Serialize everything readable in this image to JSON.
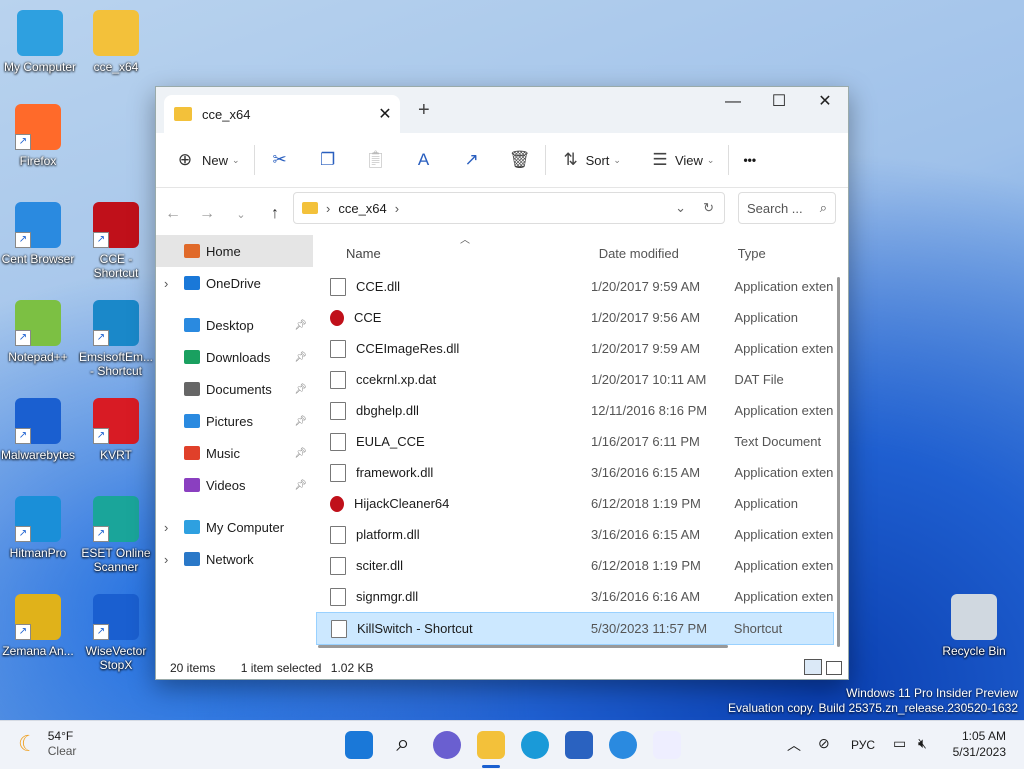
{
  "desktop": {
    "icons": [
      {
        "label": "My Computer",
        "color": "#2ea0e0"
      },
      {
        "label": "cce_x64",
        "color": "#f3c13a"
      },
      {
        "label": "Firefox",
        "color": "#ff6a2a"
      },
      {
        "label": "Cent Browser",
        "color": "#2a8ae0"
      },
      {
        "label": "CCE - Shortcut",
        "color": "#c0101a"
      },
      {
        "label": "Notepad++",
        "color": "#7cc043"
      },
      {
        "label": "EmsisoftEm... - Shortcut",
        "color": "#1a88c9"
      },
      {
        "label": "Malwarebytes",
        "color": "#1a5fd0"
      },
      {
        "label": "KVRT",
        "color": "#d81b24"
      },
      {
        "label": "HitmanPro",
        "color": "#1a8fd8"
      },
      {
        "label": "ESET Online Scanner",
        "color": "#1aa59a"
      },
      {
        "label": "Zemana An...",
        "color": "#e0b21a"
      },
      {
        "label": "WiseVector StopX",
        "color": "#1a5fd0"
      },
      {
        "label": "Recycle Bin",
        "color": "#d0d8e0"
      }
    ]
  },
  "window": {
    "tab_title": "cce_x64",
    "toolbar": {
      "new_label": "New",
      "sort_label": "Sort",
      "view_label": "View",
      "more_label": "•••"
    },
    "address": {
      "path": "cce_x64",
      "search_placeholder": "Search ..."
    },
    "sidebar": {
      "items": [
        {
          "label": "Home",
          "icon": "home-icon"
        },
        {
          "label": "OneDrive",
          "icon": "cloud-icon"
        },
        {
          "label": "Desktop",
          "icon": "desktop-icon"
        },
        {
          "label": "Downloads",
          "icon": "download-icon"
        },
        {
          "label": "Documents",
          "icon": "documents-icon"
        },
        {
          "label": "Pictures",
          "icon": "pictures-icon"
        },
        {
          "label": "Music",
          "icon": "music-icon"
        },
        {
          "label": "Videos",
          "icon": "videos-icon"
        },
        {
          "label": "My Computer",
          "icon": "computer-icon"
        },
        {
          "label": "Network",
          "icon": "network-icon"
        }
      ]
    },
    "columns": {
      "name": "Name",
      "date": "Date modified",
      "type": "Type"
    },
    "files": [
      {
        "name": "CCE.dll",
        "date": "1/20/2017 9:59 AM",
        "type": "Application exten"
      },
      {
        "name": "CCE",
        "date": "1/20/2017 9:56 AM",
        "type": "Application"
      },
      {
        "name": "CCEImageRes.dll",
        "date": "1/20/2017 9:59 AM",
        "type": "Application exten"
      },
      {
        "name": "ccekrnl.xp.dat",
        "date": "1/20/2017 10:11 AM",
        "type": "DAT File"
      },
      {
        "name": "dbghelp.dll",
        "date": "12/11/2016 8:16 PM",
        "type": "Application exten"
      },
      {
        "name": "EULA_CCE",
        "date": "1/16/2017 6:11 PM",
        "type": "Text Document"
      },
      {
        "name": "framework.dll",
        "date": "3/16/2016 6:15 AM",
        "type": "Application exten"
      },
      {
        "name": "HijackCleaner64",
        "date": "6/12/2018 1:19 PM",
        "type": "Application"
      },
      {
        "name": "platform.dll",
        "date": "3/16/2016 6:15 AM",
        "type": "Application exten"
      },
      {
        "name": "sciter.dll",
        "date": "6/12/2018 1:19 PM",
        "type": "Application exten"
      },
      {
        "name": "signmgr.dll",
        "date": "3/16/2016 6:16 AM",
        "type": "Application exten"
      },
      {
        "name": "KillSwitch - Shortcut",
        "date": "5/30/2023 11:57 PM",
        "type": "Shortcut"
      }
    ],
    "status": {
      "count": "20 items",
      "selected": "1 item selected",
      "size": "1.02 KB"
    }
  },
  "watermark": {
    "line1": "Windows 11 Pro Insider Preview",
    "line2": "Evaluation copy. Build 25375.zn_release.230520-1632"
  },
  "taskbar": {
    "weather_temp": "54°F",
    "weather_desc": "Clear",
    "lang": "РУС",
    "time": "1:05 AM",
    "date": "5/31/2023"
  }
}
